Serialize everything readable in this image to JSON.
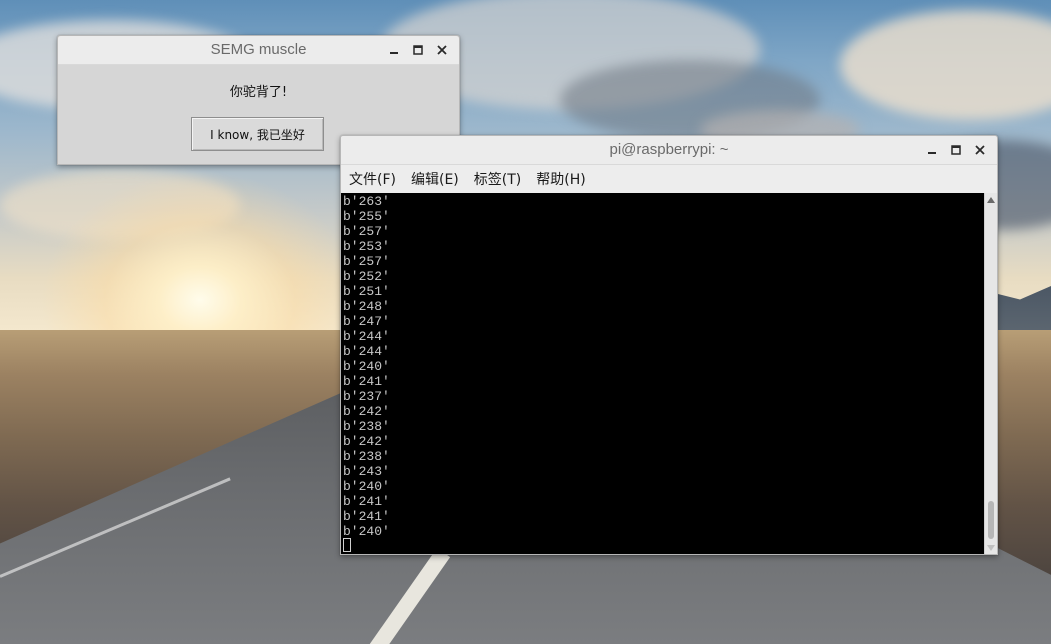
{
  "dialog": {
    "title": "SEMG muscle",
    "message": "你驼背了!",
    "button_label": "I know, 我已坐好",
    "controls": {
      "minimize_icon": "minimize-icon",
      "maximize_icon": "maximize-icon",
      "close_icon": "close-icon"
    }
  },
  "terminal": {
    "title": "pi@raspberrypi: ~",
    "menu": [
      {
        "label": "文件(F)"
      },
      {
        "label": "编辑(E)"
      },
      {
        "label": "标签(T)"
      },
      {
        "label": "帮助(H)"
      }
    ],
    "output_lines": [
      "b'263'",
      "b'255'",
      "b'257'",
      "b'253'",
      "b'257'",
      "b'252'",
      "b'251'",
      "b'248'",
      "b'247'",
      "b'244'",
      "b'244'",
      "b'240'",
      "b'241'",
      "b'237'",
      "b'242'",
      "b'238'",
      "b'242'",
      "b'238'",
      "b'243'",
      "b'240'",
      "b'241'",
      "b'241'",
      "b'240'"
    ],
    "colors": {
      "background": "#000000",
      "foreground": "#c8c8c8"
    }
  },
  "theme": {
    "titlebar_text": "#6a6a6a",
    "window_bg": "#d6d6d6"
  }
}
